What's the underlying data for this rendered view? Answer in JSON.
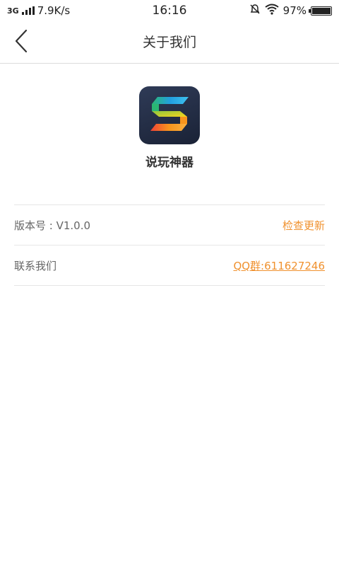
{
  "status_bar": {
    "network": "3G",
    "speed": "7.9K/s",
    "time": "16:16",
    "battery": "97%"
  },
  "header": {
    "title": "关于我们",
    "back_icon": "chevron-left-icon"
  },
  "app": {
    "name": "说玩神器",
    "logo_icon": "s-logo-icon"
  },
  "info": {
    "version_label": "版本号 : V1.0.0",
    "check_update": "检查更新",
    "contact_label": "联系我们",
    "qq_group": "QQ群:611627246"
  },
  "colors": {
    "accent": "#f0912e",
    "logo_bg": "#243049"
  }
}
